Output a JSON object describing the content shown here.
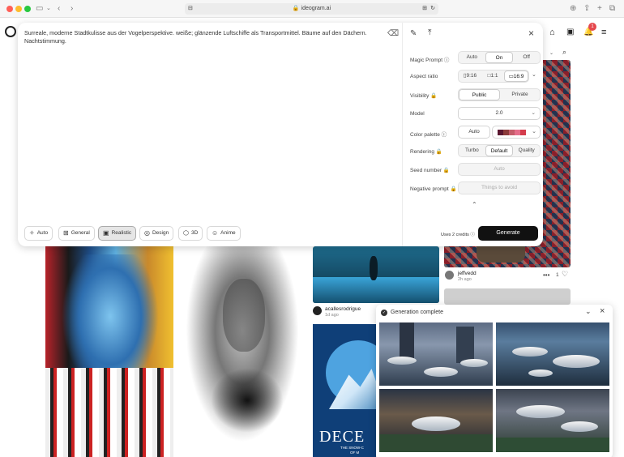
{
  "browser": {
    "url": "ideogram.ai"
  },
  "prompt": {
    "text": "Surreale, moderne Stadtkulisse aus der Vogelperspektive. weiße; glänzende Luftschiffe als Transportmittel. Bäume auf den Dächern. Nachtstimmung."
  },
  "styles": [
    {
      "label": "Auto",
      "icon": "sparkle-icon"
    },
    {
      "label": "General",
      "icon": "grid-icon"
    },
    {
      "label": "Realistic",
      "icon": "camera-icon",
      "active": true
    },
    {
      "label": "Design",
      "icon": "palette-icon"
    },
    {
      "label": "3D",
      "icon": "cube-icon"
    },
    {
      "label": "Anime",
      "icon": "smile-icon"
    }
  ],
  "settings": {
    "magic_prompt": {
      "label": "Magic Prompt ⓘ",
      "options": [
        "Auto",
        "On",
        "Off"
      ],
      "selected": "On"
    },
    "aspect_ratio": {
      "label": "Aspect ratio",
      "options": [
        "9:16",
        "1:1",
        "16:9"
      ],
      "selected": "16:9"
    },
    "visibility": {
      "label": "Visibility 🔒",
      "options": [
        "Public",
        "Private"
      ],
      "selected": "Public"
    },
    "model": {
      "label": "Model",
      "value": "2.0"
    },
    "color_palette": {
      "label": "Color palette ⓘ",
      "value": "Auto",
      "swatches": [
        "#5a1730",
        "#8c3b3b",
        "#c45c6a",
        "#e56d8a",
        "#d43c4c"
      ]
    },
    "rendering": {
      "label": "Rendering 🔒",
      "options": [
        "Turbo",
        "Default",
        "Quality"
      ],
      "selected": "Default"
    },
    "seed": {
      "label": "Seed number 🔒",
      "placeholder": "Auto"
    },
    "negative_prompt": {
      "label": "Negative prompt 🔒",
      "placeholder": "Things to avoid"
    }
  },
  "generate": {
    "credits": "Uses 2 credits ⓘ",
    "button": "Generate"
  },
  "feed": {
    "post1": {
      "user": "acallesrodrigue",
      "time": "1d ago"
    },
    "post2": {
      "user": "jeffvedd",
      "time": "2h ago",
      "likes": "1"
    },
    "poster_text": {
      "title": "DECE",
      "subtitle": "THE SNOW-C",
      "sub2": "OF M"
    }
  },
  "nav": {
    "notif_count": "1"
  },
  "notification": {
    "title": "Generation complete"
  }
}
